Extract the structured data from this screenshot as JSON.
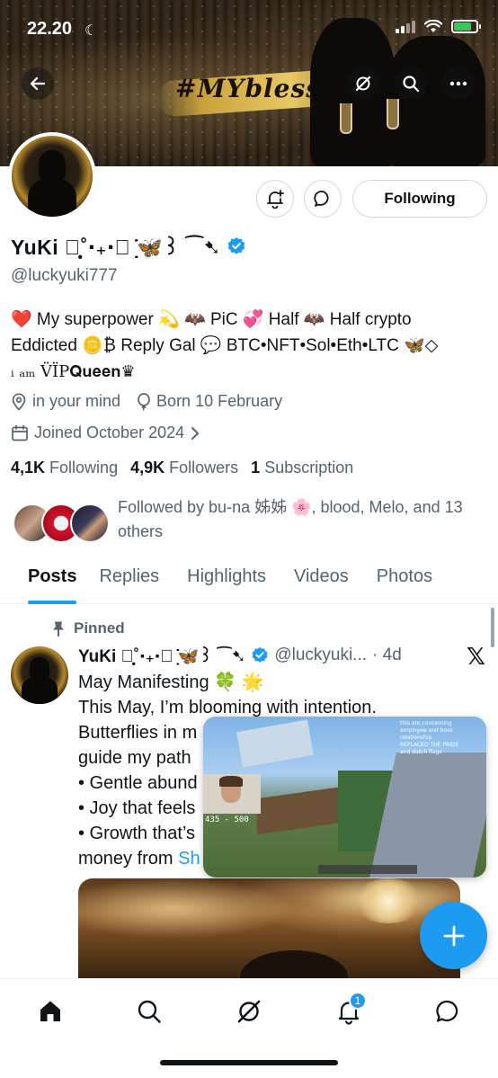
{
  "status_bar": {
    "time": "22.20"
  },
  "banner": {
    "text": "#MYblessED"
  },
  "profile": {
    "display_name": "YuKi ᭄̣̣̥˚‧₊‧﹏ ̣̇🦋꒱ ⁀➷",
    "handle": "@luckyuki777",
    "following_button": "Following",
    "bio_line1": "❤️ My superpower 💫 🦇 PiC 💞 Half 🦇 Half crypto",
    "bio_line2": "Eddicted 🪙₿ Reply Gal 💬 BTC•NFT•Sol•Eth•LTC 🦋◇",
    "bio_line3": "ᵢ ₐₘ V̈ÏP𝐐𝐮𝐞𝐞𝐧♛",
    "location": "in your mind",
    "birthday": "Born 10 February",
    "joined": "Joined October 2024",
    "following_count": "4,1K",
    "following_label": "Following",
    "followers_count": "4,9K",
    "followers_label": "Followers",
    "subscription_count": "1",
    "subscription_label": "Subscription",
    "followed_by": "Followed by bu-na 姊姊 🌸, blood, Melo, and 13 others"
  },
  "tabs": [
    {
      "label": "Posts",
      "active": true
    },
    {
      "label": "Replies"
    },
    {
      "label": "Highlights"
    },
    {
      "label": "Videos"
    },
    {
      "label": "Photos"
    }
  ],
  "post": {
    "pinned_label": "Pinned",
    "author_name": "YuKi ᭄̣̣̥˚‧₊‧﹏ ̣̇🦋꒱ ⁀➷",
    "author_handle": "@luckyuki...",
    "time": "· 4d",
    "lines": [
      "May Manifesting 🍀 🌟",
      "This May, I’m blooming with intention.",
      "Butterflies in m",
      "guide my path",
      "• Gentle abund",
      "• Joy that feels",
      "• Growth that’s"
    ],
    "last_line_prefix": "money from ",
    "last_line_link": "Sh"
  },
  "pip": {
    "score": "435 - 500",
    "overlay_lines": [
      "this are concerning",
      "employee and boss relationship",
      "REPLACED THE PRIDE",
      "and dutch flags"
    ]
  },
  "nav": {
    "notifications_badge": "1"
  },
  "colors": {
    "accent": "#1d9bf0",
    "text": "#0f1419",
    "muted": "#536471"
  }
}
